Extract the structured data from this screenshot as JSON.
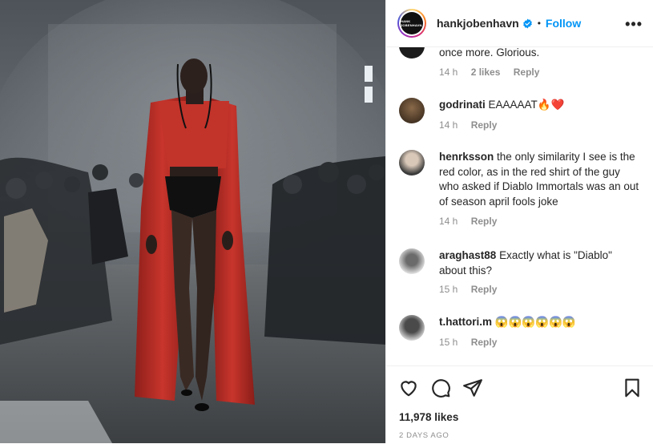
{
  "post": {
    "username": "hankjobenhavn",
    "separator": "•",
    "follow_label": "Follow",
    "more_label": "•••",
    "logo_text": "HANK JOBENHAVN"
  },
  "comments": [
    {
      "username": "",
      "text": "once more. Glorious.",
      "time": "14 h",
      "likes": "2 likes",
      "reply": "Reply"
    },
    {
      "username": "godrinati",
      "text": "EAAAAAT🔥❤️",
      "time": "14 h",
      "likes": "",
      "reply": "Reply"
    },
    {
      "username": "henrksson",
      "text": "the only similarity I see is the red color, as in the red shirt of the guy who asked if Diablo Immortals was an out of season april fools joke",
      "time": "14 h",
      "likes": "",
      "reply": "Reply"
    },
    {
      "username": "araghast88",
      "text": "Exactly what is \"Diablo\" about this?",
      "time": "15 h",
      "likes": "",
      "reply": "Reply"
    },
    {
      "username": "t.hattori.m",
      "text": "😱😱😱😱😱😱",
      "time": "15 h",
      "likes": "",
      "reply": "Reply"
    }
  ],
  "footer": {
    "likes": "11,978 likes",
    "posted": "2 DAYS AGO"
  },
  "icons": {
    "like": "heart-icon",
    "comment": "comment-bubble-icon",
    "share": "paper-plane-icon",
    "save": "bookmark-icon",
    "verified": "verified-badge-icon"
  },
  "colors": {
    "follow": "#0095f6",
    "verified": "#0095f6",
    "muted": "#8e8e8e",
    "text": "#262626"
  }
}
